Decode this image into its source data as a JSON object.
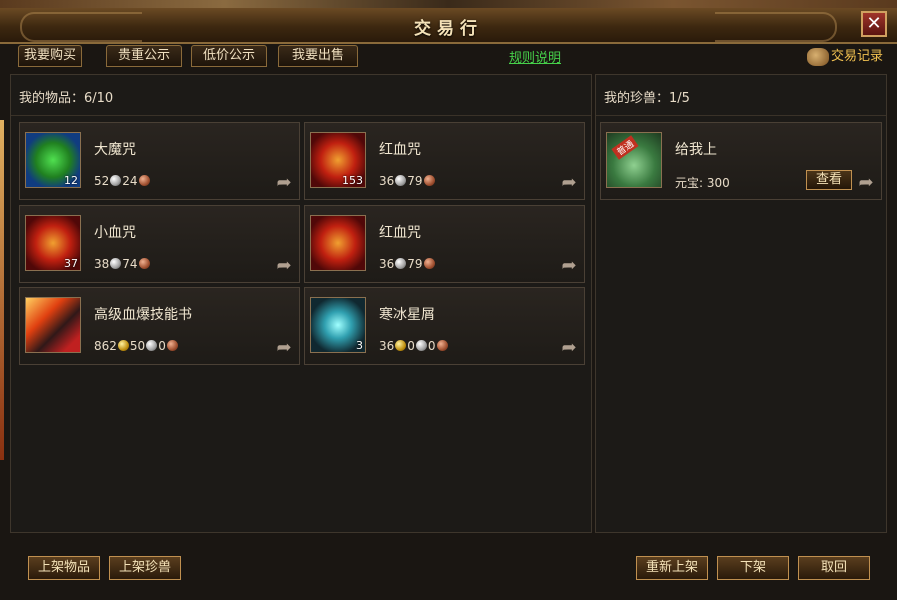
{
  "window": {
    "title": "交易行"
  },
  "tabs": [
    "我要购买",
    "贵重公示",
    "低价公示",
    "我要出售"
  ],
  "links": {
    "rules": "规则说明",
    "records": "交易记录"
  },
  "items_panel": {
    "header": "我的物品：6/10",
    "items": [
      {
        "name": "大魔咒",
        "qty": "12",
        "icon": "green-scroll-icon",
        "price": {
          "silver": "52",
          "copper": "24"
        }
      },
      {
        "name": "红血咒",
        "qty": "153",
        "icon": "red-scroll-icon",
        "price": {
          "silver": "36",
          "copper": "79"
        }
      },
      {
        "name": "小血咒",
        "qty": "37",
        "icon": "red-scroll-icon",
        "price": {
          "silver": "38",
          "copper": "74"
        }
      },
      {
        "name": "红血咒",
        "qty": "",
        "icon": "red-scroll-icon",
        "price": {
          "silver": "36",
          "copper": "79"
        }
      },
      {
        "name": "高级血爆技能书",
        "qty": "",
        "icon": "blade-skill-book-icon",
        "price": {
          "gold": "862",
          "silver": "50",
          "copper": "0"
        }
      },
      {
        "name": "寒冰星屑",
        "qty": "3",
        "icon": "ice-star-dust-icon",
        "price": {
          "gold": "36",
          "silver": "0",
          "copper": "0"
        }
      }
    ]
  },
  "pets_panel": {
    "header": "我的珍兽：1/5",
    "pets": [
      {
        "name": "给我上",
        "tag": "普通",
        "currency_label": "元宝:",
        "currency_value": "300",
        "view_label": "查看"
      }
    ]
  },
  "buttons": {
    "list_item": "上架物品",
    "list_pet": "上架珍兽",
    "relist": "重新上架",
    "delist": "下架",
    "retrieve": "取回"
  }
}
